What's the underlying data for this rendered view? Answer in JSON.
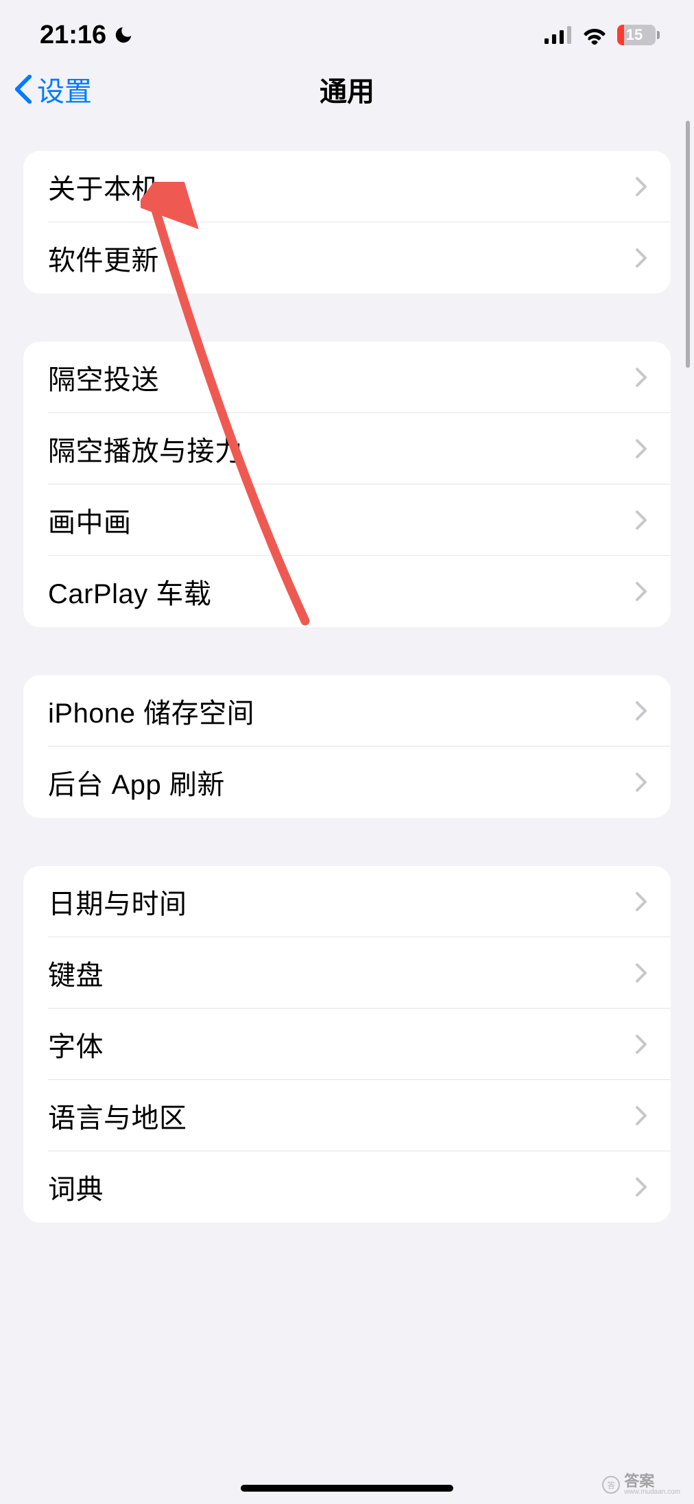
{
  "statusBar": {
    "time": "21:16",
    "batteryLevel": "15"
  },
  "nav": {
    "backLabel": "设置",
    "title": "通用"
  },
  "groups": [
    {
      "rows": [
        {
          "name": "about-device",
          "label": "关于本机"
        },
        {
          "name": "software-update",
          "label": "软件更新"
        }
      ]
    },
    {
      "rows": [
        {
          "name": "airdrop",
          "label": "隔空投送"
        },
        {
          "name": "airplay-handoff",
          "label": "隔空播放与接力"
        },
        {
          "name": "picture-in-picture",
          "label": "画中画"
        },
        {
          "name": "carplay",
          "label": "CarPlay 车载"
        }
      ]
    },
    {
      "rows": [
        {
          "name": "iphone-storage",
          "label": "iPhone 储存空间"
        },
        {
          "name": "background-app-refresh",
          "label": "后台 App 刷新"
        }
      ]
    },
    {
      "rows": [
        {
          "name": "date-time",
          "label": "日期与时间"
        },
        {
          "name": "keyboard",
          "label": "键盘"
        },
        {
          "name": "fonts",
          "label": "字体"
        },
        {
          "name": "language-region",
          "label": "语言与地区"
        },
        {
          "name": "dictionary",
          "label": "词典"
        }
      ]
    }
  ],
  "watermark": {
    "main": "答案",
    "sub": "www.mudaan.com"
  }
}
